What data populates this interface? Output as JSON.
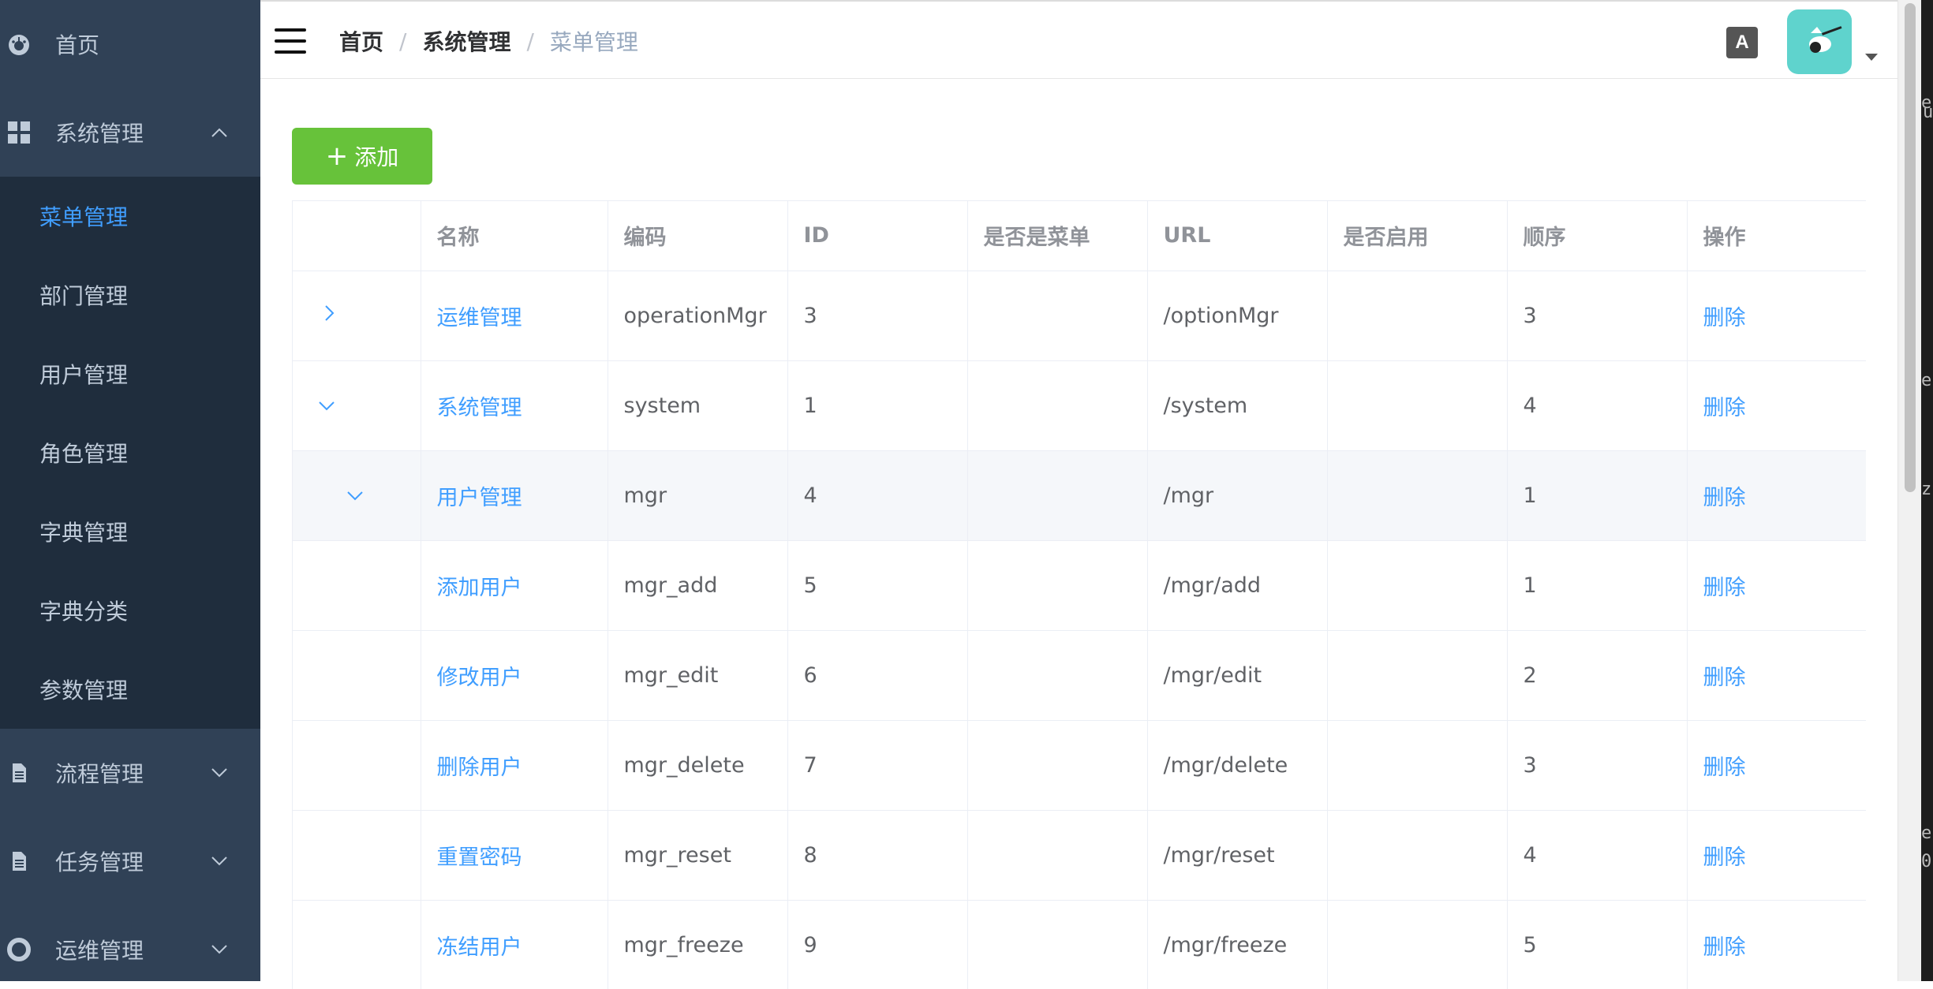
{
  "sidebar": {
    "top_items": [
      {
        "label": "首页",
        "icon": "dashboard-icon"
      },
      {
        "label": "系统管理",
        "icon": "grid-icon",
        "expanded": true
      },
      {
        "label": "流程管理",
        "icon": "document-icon",
        "expanded": false
      },
      {
        "label": "任务管理",
        "icon": "document-icon",
        "expanded": false
      },
      {
        "label": "运维管理",
        "icon": "lifebuoy-icon",
        "expanded": false
      }
    ],
    "sub_items": [
      "菜单管理",
      "部门管理",
      "用户管理",
      "角色管理",
      "字典管理",
      "字典分类",
      "参数管理"
    ],
    "active_sub": "菜单管理",
    "colors": {
      "bg": "#304156",
      "submenu_bg": "#1f2d3d",
      "text": "#bfcbd9",
      "active": "#409eff"
    }
  },
  "header": {
    "breadcrumb": [
      "首页",
      "系统管理",
      "菜单管理"
    ],
    "separator": "/",
    "translate_glyph": "A"
  },
  "toolbar": {
    "add_label": "添加",
    "add_color": "#67c23a"
  },
  "table": {
    "columns": [
      "",
      "名称",
      "编码",
      "ID",
      "是否是菜单",
      "URL",
      "是否启用",
      "顺序",
      "操作"
    ],
    "rows": [
      {
        "expander": "collapsed",
        "name": "运维管理",
        "code": "operationMgr",
        "id": "3",
        "is_menu": "",
        "url": "/optionMgr",
        "enabled": "",
        "order": "3",
        "action": "删除"
      },
      {
        "expander": "expanded",
        "name": "系统管理",
        "code": "system",
        "id": "1",
        "is_menu": "",
        "url": "/system",
        "enabled": "",
        "order": "4",
        "action": "删除"
      },
      {
        "expander": "expanded-child",
        "name": "用户管理",
        "code": "mgr",
        "id": "4",
        "is_menu": "",
        "url": "/mgr",
        "enabled": "",
        "order": "1",
        "action": "删除"
      },
      {
        "expander": "",
        "name": "添加用户",
        "code": "mgr_add",
        "id": "5",
        "is_menu": "",
        "url": "/mgr/add",
        "enabled": "",
        "order": "1",
        "action": "删除"
      },
      {
        "expander": "",
        "name": "修改用户",
        "code": "mgr_edit",
        "id": "6",
        "is_menu": "",
        "url": "/mgr/edit",
        "enabled": "",
        "order": "2",
        "action": "删除"
      },
      {
        "expander": "",
        "name": "删除用户",
        "code": "mgr_delete",
        "id": "7",
        "is_menu": "",
        "url": "/mgr/delete",
        "enabled": "",
        "order": "3",
        "action": "删除"
      },
      {
        "expander": "",
        "name": "重置密码",
        "code": "mgr_reset",
        "id": "8",
        "is_menu": "",
        "url": "/mgr/reset",
        "enabled": "",
        "order": "4",
        "action": "删除"
      },
      {
        "expander": "",
        "name": "冻结用户",
        "code": "mgr_freeze",
        "id": "9",
        "is_menu": "",
        "url": "/mgr/freeze",
        "enabled": "",
        "order": "5",
        "action": "删除"
      }
    ],
    "highlight_row": 2
  },
  "right_strip_glyphs": [
    "e",
    "u",
    "e",
    "z",
    "e.",
    "0"
  ]
}
